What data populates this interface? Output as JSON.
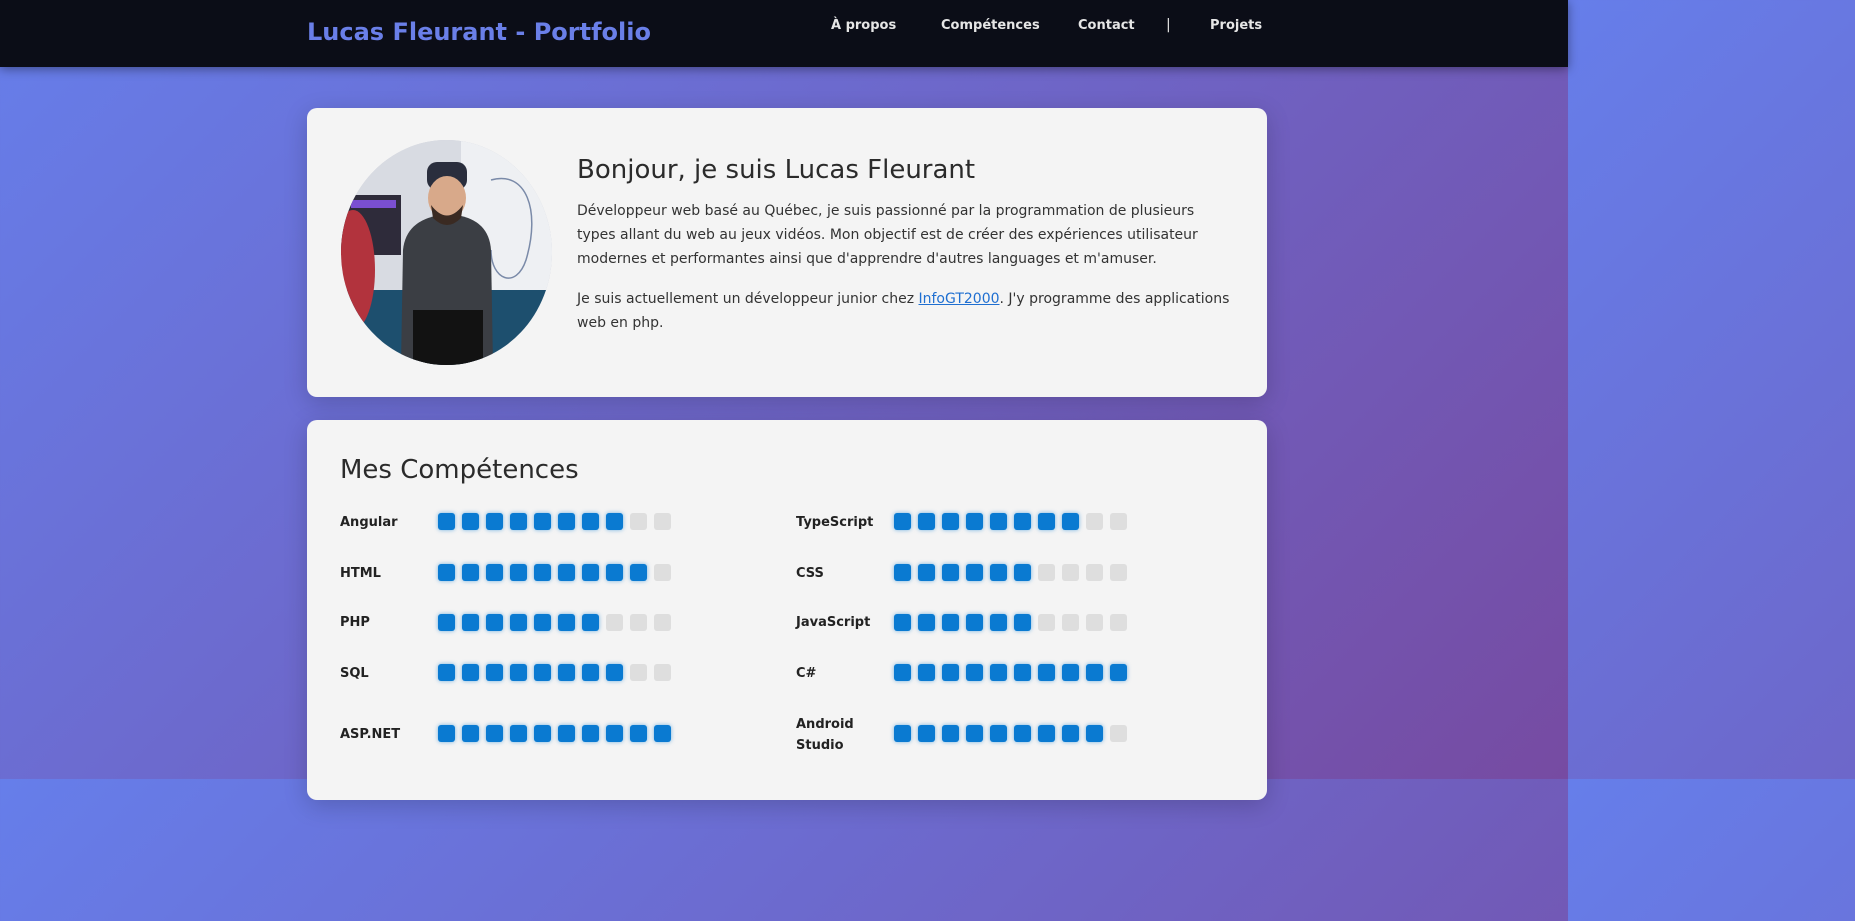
{
  "header": {
    "brand": "Lucas Fleurant - Portfolio",
    "nav": [
      "À propos",
      "Compétences",
      "Contact",
      "Projets"
    ],
    "separator": "|"
  },
  "about": {
    "heading": "Bonjour, je suis Lucas Fleurant",
    "paragraph1": "Développeur web basé au Québec, je suis passionné par la programmation de plusieurs types allant du web au jeux vidéos. Mon objectif est de créer des expériences utilisateur modernes et performantes ainsi que d'apprendre d'autres languages et m'amuser.",
    "paragraph2_before": "Je suis actuellement un développeur junior chez ",
    "paragraph2_link": "InfoGT2000",
    "paragraph2_after": ". J'y programme des applications web en php."
  },
  "skills": {
    "heading": "Mes Compétences",
    "max_level": 10,
    "items": [
      {
        "name": "Angular",
        "level": 8
      },
      {
        "name": "TypeScript",
        "level": 8
      },
      {
        "name": "HTML",
        "level": 9
      },
      {
        "name": "CSS",
        "level": 6
      },
      {
        "name": "PHP",
        "level": 7
      },
      {
        "name": "JavaScript",
        "level": 6
      },
      {
        "name": "SQL",
        "level": 8
      },
      {
        "name": "C#",
        "level": 10
      },
      {
        "name": "ASP.NET",
        "level": 10
      },
      {
        "name": "Android Studio",
        "level": 9
      }
    ]
  },
  "colors": {
    "accent": "#0a7ad1",
    "brand": "#6a7fe8",
    "header_bg": "#0b0d17",
    "card_bg": "#f4f4f4"
  }
}
